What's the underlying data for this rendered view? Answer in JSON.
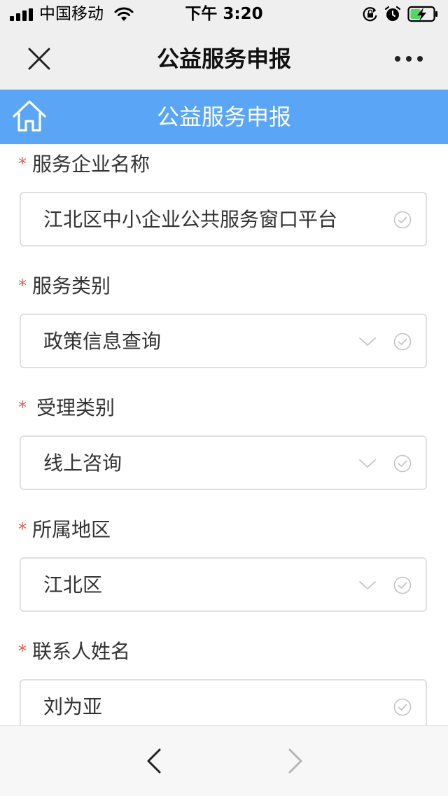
{
  "status_bar": {
    "carrier": "中国移动",
    "time": "下午 3:20",
    "icons": [
      "signal-icon",
      "wifi-icon",
      "orientation-lock-icon",
      "alarm-icon",
      "battery-charging-icon"
    ]
  },
  "nav": {
    "title": "公益服务申报",
    "close_icon": "close-icon",
    "more_icon": "more-icon"
  },
  "header": {
    "title": "公益服务申报",
    "home_icon": "home-icon"
  },
  "form": {
    "required_mark": "*",
    "fields": [
      {
        "label": "服务企业名称",
        "value": "江北区中小企业公共服务窗口平台",
        "type": "text"
      },
      {
        "label": "服务类别",
        "value": "政策信息查询",
        "type": "select"
      },
      {
        "label": "受理类别",
        "value": "线上咨询",
        "type": "select"
      },
      {
        "label": "所属地区",
        "value": "江北区",
        "type": "select"
      },
      {
        "label": "联系人姓名",
        "value": "刘为亚",
        "type": "text"
      }
    ]
  },
  "bottom_bar": {
    "back_icon": "chevron-left-icon",
    "forward_icon": "chevron-right-icon"
  },
  "colors": {
    "header_blue": "#5aa5f6",
    "required_red": "#e25b4f",
    "bar_gray": "#efefef"
  }
}
